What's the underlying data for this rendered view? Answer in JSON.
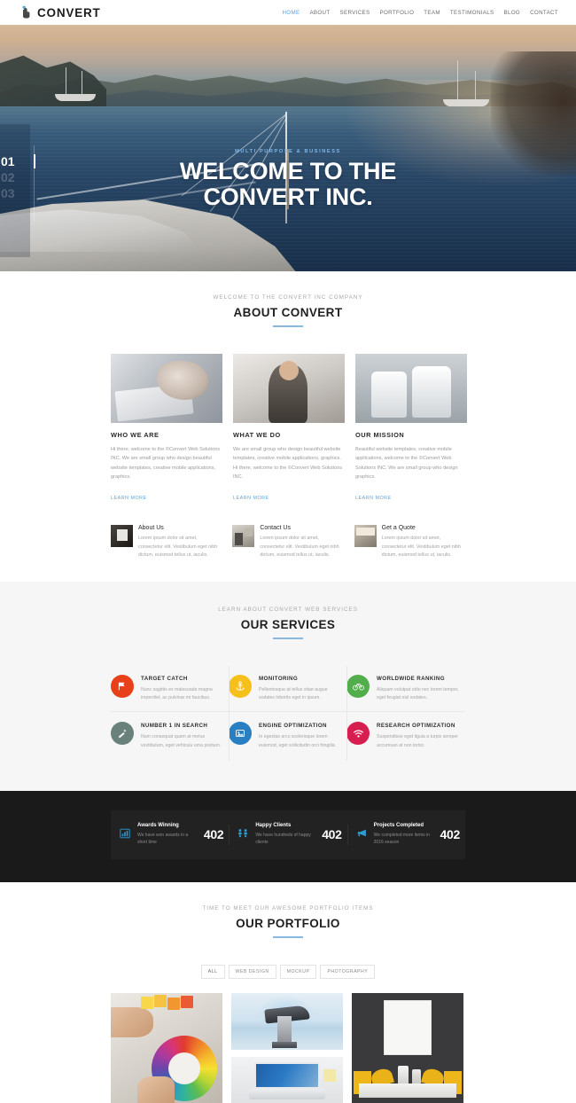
{
  "header": {
    "logo_text": "CONVERT",
    "logo_icon": "hand-click-icon",
    "nav": [
      {
        "label": "HOME",
        "active": true
      },
      {
        "label": "ABOUT",
        "active": false
      },
      {
        "label": "SERVICES",
        "active": false
      },
      {
        "label": "PORTFOLIO",
        "active": false
      },
      {
        "label": "TEAM",
        "active": false
      },
      {
        "label": "TESTIMONIALS",
        "active": false
      },
      {
        "label": "BLOG",
        "active": false
      },
      {
        "label": "CONTACT",
        "active": false
      }
    ]
  },
  "hero": {
    "subtitle": "MULTI PURPOSE & BUSINESS",
    "title_line1": "WELCOME TO THE",
    "title_line2": "CONVERT INC.",
    "slides": [
      "01",
      "02",
      "03"
    ],
    "active_slide": "01"
  },
  "about": {
    "pre_title": "WELCOME TO THE CONVERT INC COMPANY",
    "title": "ABOUT CONVERT",
    "columns": [
      {
        "heading": "WHO WE ARE",
        "text": "Hi there, welcome to the ©Convert Web Solutions INC. We are small group who design beautiful website templates, creative mobile applications, graphics.",
        "link": "LEARN MORE"
      },
      {
        "heading": "WHAT WE DO",
        "text": "We are small group who design beautiful website templates, creative mobile applications, graphics. Hi there, welcome to the ©Convert Web Solutions INC.",
        "link": "LEARN MORE"
      },
      {
        "heading": "OUR MISSION",
        "text": "Beautiful website templates, creative mobile applications, welcome to the ©Convert Web Solutions INC. We are small group who design graphics.",
        "link": "LEARN MORE"
      }
    ],
    "mini_cards": [
      {
        "heading": "About Us",
        "text": "Lorem ipsum dolor sit amet, consectetur elit. Vestibulum eget nibh dictum, euismod tellus ut, iaculis."
      },
      {
        "heading": "Contact Us",
        "text": "Lorem ipsum dolor sit amet, consectetur elit. Vestibulum eget nibh dictum, euismod tellus ut, iaculis."
      },
      {
        "heading": "Get a Quote",
        "text": "Lorem ipsum dolor sit amet, consectetur elit. Vestibulum eget nibh dictum, euismod tellus ut, iaculis."
      }
    ]
  },
  "services": {
    "pre_title": "LEARN ABOUT CONVERT WEB SERVICES",
    "title": "OUR SERVICES",
    "items": [
      {
        "heading": "TARGET CATCH",
        "text": "Nunc sagittis ex malesuada magna imperdiet, ac pulvinar mi faucibus.",
        "icon": "target-flag-icon",
        "color": "#e8411a",
        "glyph": "⚑"
      },
      {
        "heading": "MONITORING",
        "text": "Pellentesque at tellus vitae augue sodales lobortis eget in ipsum.",
        "icon": "anchor-icon",
        "color": "#f5c019",
        "glyph": "⚓"
      },
      {
        "heading": "WORLDWIDE RANKING",
        "text": "Aliquam volutpat odio nec lorem tempor, eget feugiat nisl sodales.",
        "icon": "bicycle-icon",
        "color": "#52ad4b",
        "glyph": "⚲"
      },
      {
        "heading": "NUMBER 1 IN SEARCH",
        "text": "Nam consequat quam at metus vestibulum, eget vehicula urna pretium.",
        "icon": "magic-wand-icon",
        "color": "#68817a",
        "glyph": "✦"
      },
      {
        "heading": "ENGINE OPTIMIZATION",
        "text": "In egestas arcu scelerisque lorem euismod, eget sollicitudin orci fringilla.",
        "icon": "image-frame-icon",
        "color": "#2a7fc2",
        "glyph": "▣"
      },
      {
        "heading": "RESEARCH OPTIMIZATION",
        "text": "Suspendisse eget ligula a turpis semper accumsan at non tortor.",
        "icon": "wifi-signal-icon",
        "color": "#d61f50",
        "glyph": "◔"
      }
    ]
  },
  "counters": [
    {
      "heading": "Awards Winning",
      "text": "We have won awards in a short time",
      "number": "402",
      "icon": "bar-chart-icon",
      "glyph": "█"
    },
    {
      "heading": "Happy Clients",
      "text": "We have hundreds of happy clients",
      "number": "402",
      "icon": "people-group-icon",
      "glyph": "∷"
    },
    {
      "heading": "Projects Completed",
      "text": "We completed more items in 2016 season",
      "number": "402",
      "icon": "megaphone-icon",
      "glyph": "◀"
    }
  ],
  "portfolio": {
    "pre_title": "TIME TO MEET OUR AWESOME PORTFOLIO ITEMS",
    "title": "OUR PORTFOLIO",
    "filters": [
      {
        "label": "ALL",
        "active": true
      },
      {
        "label": "WEB DESIGN",
        "active": false
      },
      {
        "label": "MOCKUP",
        "active": false
      },
      {
        "label": "PHOTOGRAPHY",
        "active": false
      }
    ],
    "items": [
      {
        "name": "color-wheel-blueprint-photo"
      },
      {
        "name": "viewfinder-telescope-photo"
      },
      {
        "name": "laptop-desk-mockup-photo"
      },
      {
        "name": "dark-office-frame-photo"
      }
    ]
  },
  "colors": {
    "accent_blue": "#5ba4e5",
    "rule_blue": "#89b9e0",
    "dark_section": "#1a1a1a",
    "light_section": "#f6f6f6"
  }
}
